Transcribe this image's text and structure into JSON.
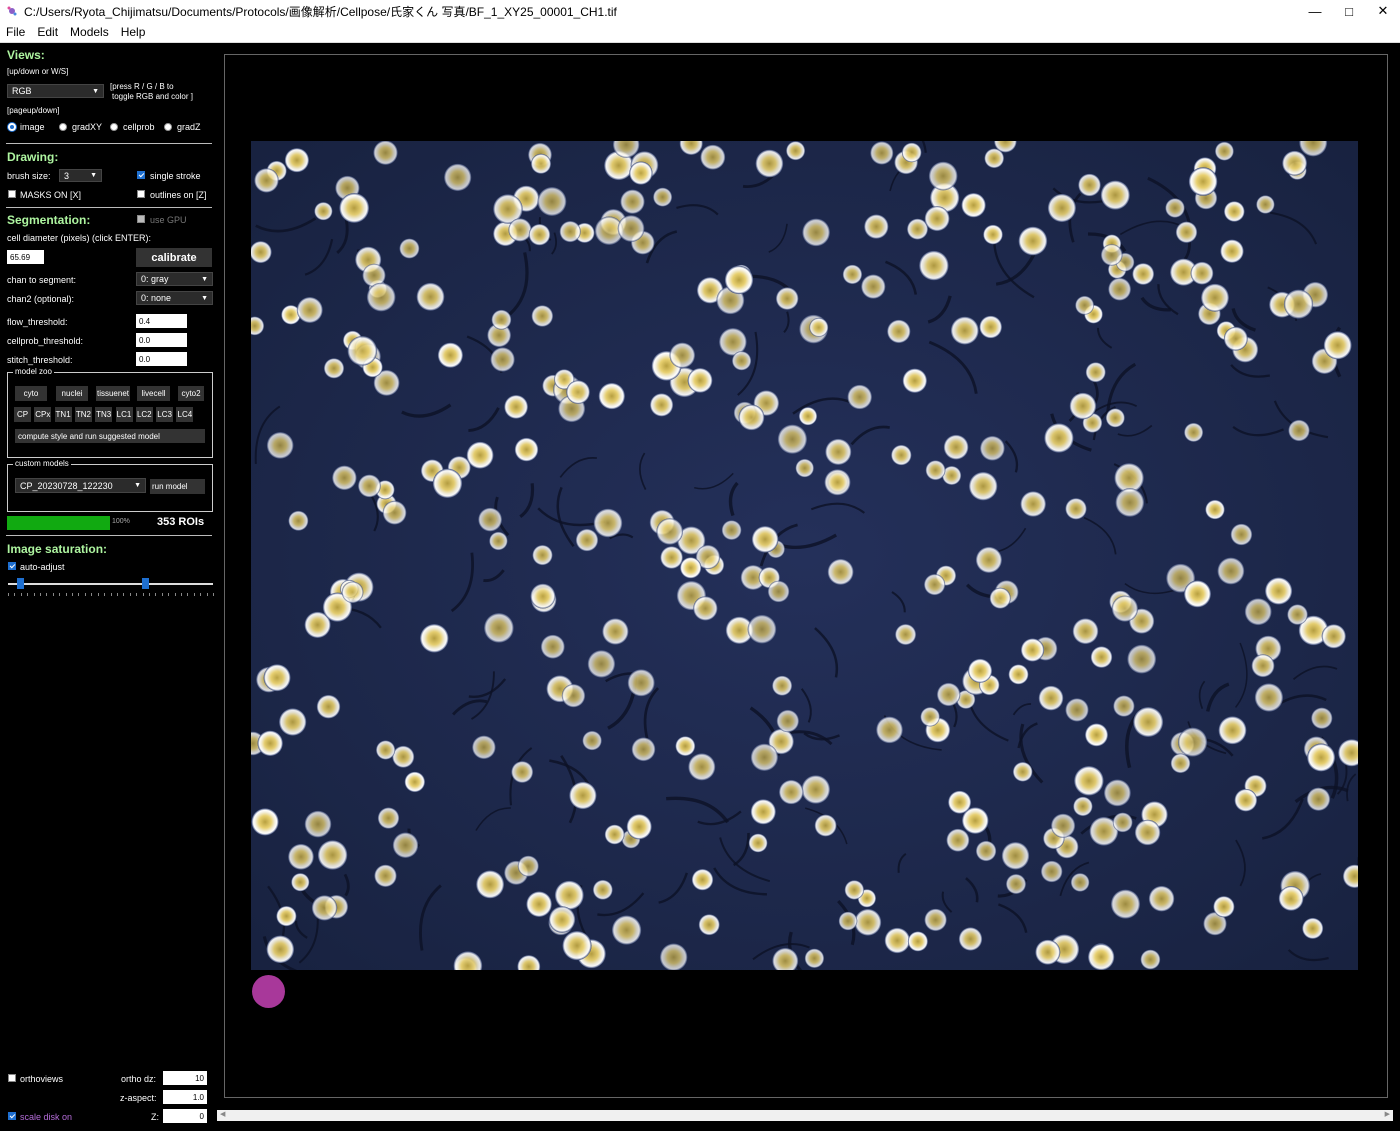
{
  "window": {
    "title": "C:/Users/Ryota_Chijimatsu/Documents/Protocols/画像解析/Cellpose/氏家くん 写真/BF_1_XY25_00001_CH1.tif",
    "minimize": "—",
    "maximize": "□",
    "close": "✕"
  },
  "menu": [
    "File",
    "Edit",
    "Models",
    "Help"
  ],
  "views": {
    "title": "Views:",
    "hint": "[up/down or W/S]",
    "view_select": "RGB",
    "rgb_hint_1": "[press R / G / B to",
    "rgb_hint_2": "toggle RGB and color ]",
    "page_hint": "[pageup/down]",
    "radios": [
      "image",
      "gradXY",
      "cellprob",
      "gradZ"
    ]
  },
  "drawing": {
    "title": "Drawing:",
    "brush_label": "brush size:",
    "brush_value": "3",
    "single_stroke": "single stroke",
    "masks_on": "MASKS ON [X]",
    "outlines_on": "outlines on [Z]"
  },
  "segmentation": {
    "title": "Segmentation:",
    "use_gpu": "use GPU",
    "diameter_label": "cell diameter (pixels) (click ENTER):",
    "diameter_value": "65.69",
    "calibrate": "calibrate",
    "chan_label": "chan to segment:",
    "chan_value": "0: gray",
    "chan2_label": "chan2 (optional):",
    "chan2_value": "0: none",
    "flow_label": "flow_threshold:",
    "flow_value": "0.4",
    "cellprob_label": "cellprob_threshold:",
    "cellprob_value": "0.0",
    "stitch_label": "stitch_threshold:",
    "stitch_value": "0.0"
  },
  "model_zoo": {
    "title": "model zoo",
    "row1": [
      "cyto",
      "nuclei",
      "tissuenet",
      "livecell",
      "cyto2"
    ],
    "row2": [
      "CP",
      "CPx",
      "TN1",
      "TN2",
      "TN3",
      "LC1",
      "LC2",
      "LC3",
      "LC4"
    ],
    "suggest": "compute style and run suggested model"
  },
  "custom_models": {
    "title": "custom models",
    "model": "CP_20230728_122230",
    "run": "run model"
  },
  "progress": {
    "value": 1.0,
    "text": "100%",
    "rois": "353 ROIs"
  },
  "saturation": {
    "title": "Image saturation:",
    "auto_adjust": "auto-adjust",
    "low": 0.06,
    "high": 0.67
  },
  "ortho": {
    "orthoviews": "orthoviews",
    "dz_label": "ortho dz:",
    "dz_value": "10",
    "zaspect_label": "z-aspect:",
    "zaspect_value": "1.0",
    "scale_disk": "scale disk on",
    "z_label": "Z:",
    "z_value": "0"
  },
  "colors": {
    "section": "#aef5a0",
    "accent": "#1e6fd0",
    "progress": "#11aa11",
    "disk": "#a8389a",
    "scale_text": "#b46cd8"
  }
}
